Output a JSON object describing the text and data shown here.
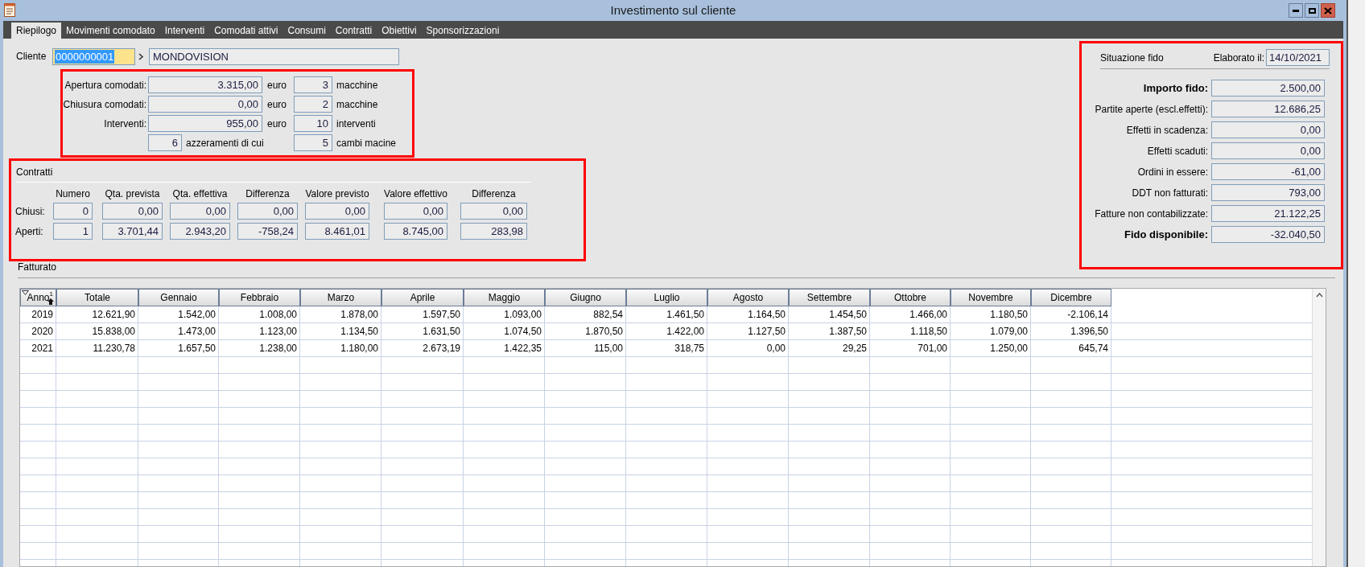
{
  "window": {
    "title": "Investimento sul cliente"
  },
  "tabs": [
    {
      "label": "Riepilogo",
      "selected": true
    },
    {
      "label": "Movimenti comodato",
      "selected": false
    },
    {
      "label": "Interventi",
      "selected": false
    },
    {
      "label": "Comodati attivi",
      "selected": false
    },
    {
      "label": "Consumi",
      "selected": false
    },
    {
      "label": "Contratti",
      "selected": false
    },
    {
      "label": "Obiettivi",
      "selected": false
    },
    {
      "label": "Sponsorizzazioni",
      "selected": false
    }
  ],
  "cliente": {
    "label": "Cliente",
    "code": "0000000001",
    "name": "MONDOVISION"
  },
  "summary": [
    {
      "kind": "amount",
      "label": "Apertura comodati:",
      "amount": "3.315,00",
      "unit": "euro",
      "count": "3",
      "count_label": "macchine"
    },
    {
      "kind": "amount",
      "label": "Chiusura comodati:",
      "amount": "0,00",
      "unit": "euro",
      "count": "2",
      "count_label": "macchine"
    },
    {
      "kind": "amount",
      "label": "Interventi:",
      "amount": "955,00",
      "unit": "euro",
      "count": "10",
      "count_label": "interventi"
    },
    {
      "kind": "count",
      "count_a": "6",
      "label_a": "azzeramenti di cui",
      "count": "5",
      "count_label": "cambi macine"
    }
  ],
  "contratti": {
    "title": "Contratti",
    "columns": [
      "Numero",
      "Qta. prevista",
      "Qta. effettiva",
      "Differenza",
      "Valore previsto",
      "Valore effettivo",
      "Differenza"
    ],
    "rows": [
      {
        "label": "Chiusi:",
        "values": [
          "0",
          "0,00",
          "0,00",
          "0,00",
          "0,00",
          "0,00",
          "0,00"
        ]
      },
      {
        "label": "Aperti:",
        "values": [
          "1",
          "3.701,44",
          "2.943,20",
          "-758,24",
          "8.461,01",
          "8.745,00",
          "283,98"
        ]
      }
    ]
  },
  "fatturato": {
    "title": "Fatturato",
    "sort_rank": "1",
    "columns": [
      "Anno",
      "Totale",
      "Gennaio",
      "Febbraio",
      "Marzo",
      "Aprile",
      "Maggio",
      "Giugno",
      "Luglio",
      "Agosto",
      "Settembre",
      "Ottobre",
      "Novembre",
      "Dicembre"
    ],
    "rows": [
      [
        "2019",
        "12.621,90",
        "1.542,00",
        "1.008,00",
        "1.878,00",
        "1.597,50",
        "1.093,00",
        "882,54",
        "1.461,50",
        "1.164,50",
        "1.454,50",
        "1.466,00",
        "1.180,50",
        "-2.106,14"
      ],
      [
        "2020",
        "15.838,00",
        "1.473,00",
        "1.123,00",
        "1.134,50",
        "1.631,50",
        "1.074,50",
        "1.870,50",
        "1.422,00",
        "1.127,50",
        "1.387,50",
        "1.118,50",
        "1.079,00",
        "1.396,50"
      ],
      [
        "2021",
        "11.230,78",
        "1.657,50",
        "1.238,00",
        "1.180,00",
        "2.673,19",
        "1.422,35",
        "115,00",
        "318,75",
        "0,00",
        "29,25",
        "701,00",
        "1.250,00",
        "645,74"
      ]
    ]
  },
  "fido": {
    "title": "Situazione fido",
    "date_label": "Elaborato il:",
    "date": "14/10/2021",
    "rows": [
      {
        "label": "Importo fido:",
        "value": "2.500,00",
        "emphasized": true
      },
      {
        "label": "Partite aperte (escl.effetti):",
        "value": "12.686,25",
        "emphasized": false
      },
      {
        "label": "Effetti in scadenza:",
        "value": "0,00",
        "emphasized": false
      },
      {
        "label": "Effetti scaduti:",
        "value": "0,00",
        "emphasized": false
      },
      {
        "label": "Ordini in essere:",
        "value": "-61,00",
        "emphasized": false
      },
      {
        "label": "DDT non fatturati:",
        "value": "793,00",
        "emphasized": false
      },
      {
        "label": "Fatture non contabilizzate:",
        "value": "21.122,25",
        "emphasized": false
      },
      {
        "label": "Fido disponibile:",
        "value": "-32.040,50",
        "emphasized": true
      }
    ]
  }
}
